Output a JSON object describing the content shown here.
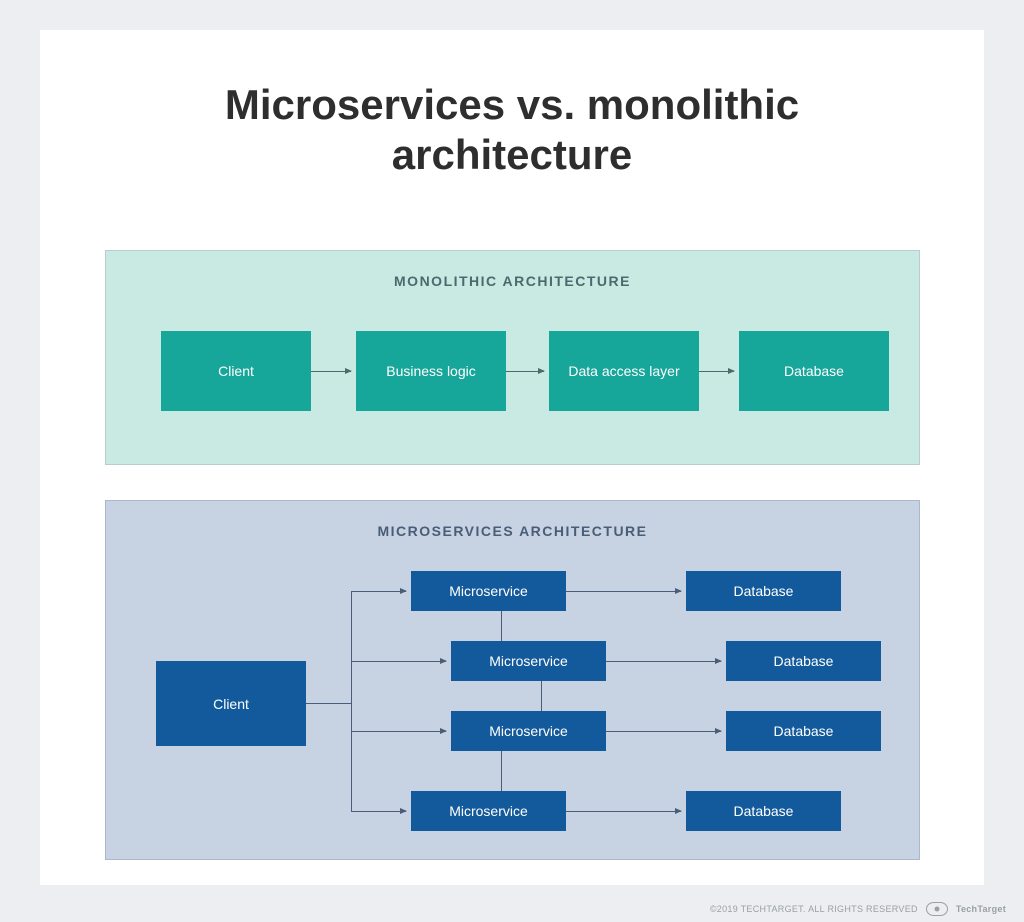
{
  "title": "Microservices vs. monolithic architecture",
  "monolithic": {
    "heading": "MONOLITHIC ARCHITECTURE",
    "boxes": [
      "Client",
      "Business logic",
      "Data access layer",
      "Database"
    ]
  },
  "microservices": {
    "heading": "MICROSERVICES ARCHITECTURE",
    "client": "Client",
    "services": [
      "Microservice",
      "Microservice",
      "Microservice",
      "Microservice"
    ],
    "databases": [
      "Database",
      "Database",
      "Database",
      "Database"
    ]
  },
  "footer": {
    "copyright": "©2019 TECHTARGET. ALL RIGHTS RESERVED",
    "brand": "TechTarget"
  }
}
